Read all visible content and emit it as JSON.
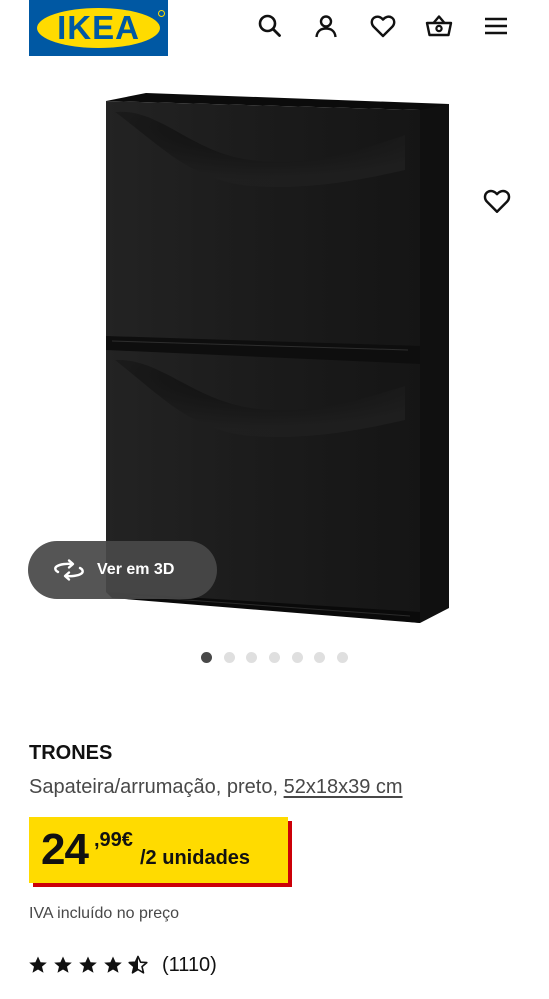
{
  "header": {
    "logo_text": "IKEA",
    "icons": [
      "search-icon",
      "account-icon",
      "wishlist-icon",
      "basket-icon",
      "menu-icon"
    ]
  },
  "gallery": {
    "view_3d_label": "Ver em 3D",
    "image_count": 7,
    "active_index": 0
  },
  "product": {
    "name": "TRONES",
    "description": "Sapateira/arrumação, preto,",
    "dimensions": "52x18x39 cm",
    "price_integer": "24",
    "price_decimal": ",99€",
    "price_unit": "/2 unidades",
    "vat_note": "IVA incluído no preço",
    "rating_stars": 4.5,
    "rating_max": 5,
    "review_count": "(1110)"
  },
  "colors": {
    "brand_blue": "#0058a3",
    "brand_yellow": "#ffdb00",
    "price_shadow_red": "#cc0008",
    "product_black": "#1e1e1e"
  }
}
